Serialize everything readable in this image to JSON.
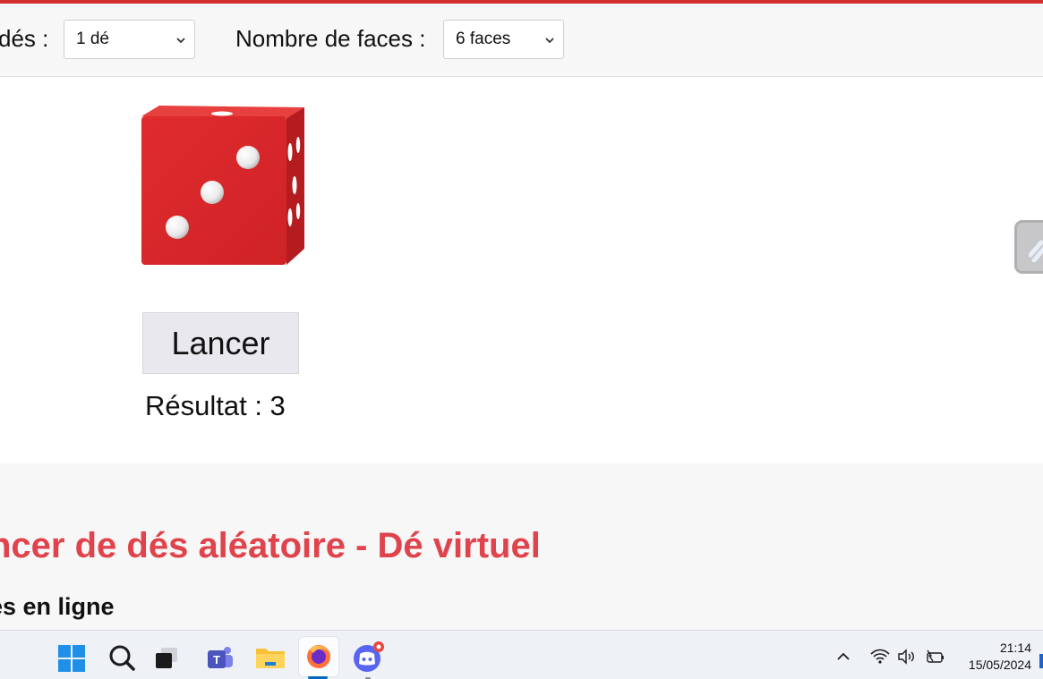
{
  "toolbar": {
    "dice_label": "dés :",
    "dice_select_value": "1 dé",
    "faces_label": "Nombre de faces :",
    "faces_select_value": "6 faces"
  },
  "die": {
    "face_value": 3,
    "color": "#d8292c"
  },
  "roll_button_label": "Lancer",
  "result_text": "Résultat : 3",
  "article": {
    "title": "ncer de dés aléatoire - Dé virtuel",
    "subtitle": "es en ligne"
  },
  "taskbar": {
    "icons": [
      "windows-start-icon",
      "search-icon",
      "task-view-icon",
      "teams-icon",
      "file-explorer-icon",
      "firefox-icon",
      "discord-icon"
    ],
    "tray_icons": [
      "chevron-up-icon",
      "wifi-icon",
      "volume-icon",
      "battery-icon"
    ],
    "time": "21:14",
    "date": "15/05/2024"
  },
  "colors": {
    "accent_red": "#e0434b",
    "top_border": "#d32f2f",
    "taskbar_active": "#0067c0"
  }
}
